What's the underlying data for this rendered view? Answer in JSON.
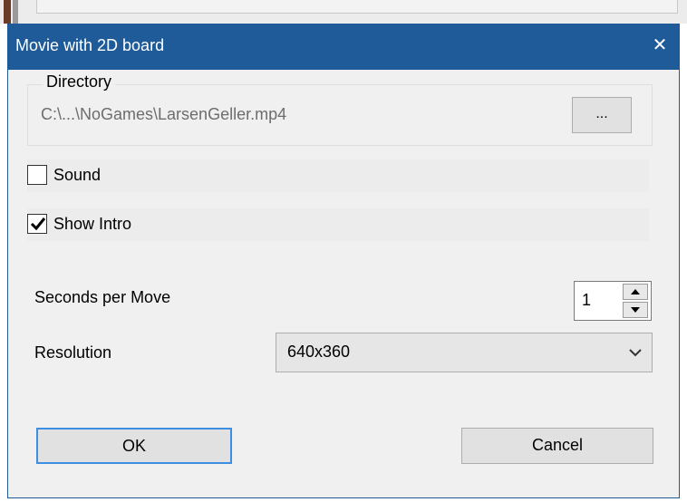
{
  "dialog": {
    "title": "Movie with 2D board",
    "close_glyph": "✕"
  },
  "directory": {
    "legend": "Directory",
    "path": "C:\\...\\NoGames\\LarsenGeller.mp4",
    "browse_label": "..."
  },
  "options": {
    "sound": {
      "label": "Sound",
      "checked": false
    },
    "show_intro": {
      "label": "Show Intro",
      "checked": true
    }
  },
  "seconds_per_move": {
    "label": "Seconds per Move",
    "value": "1"
  },
  "resolution": {
    "label": "Resolution",
    "selected": "640x360"
  },
  "buttons": {
    "ok": "OK",
    "cancel": "Cancel"
  },
  "colors": {
    "titlebar": "#1f5b98",
    "dialog_bg": "#f0f0f0",
    "default_button_border": "#3d8ee0"
  }
}
